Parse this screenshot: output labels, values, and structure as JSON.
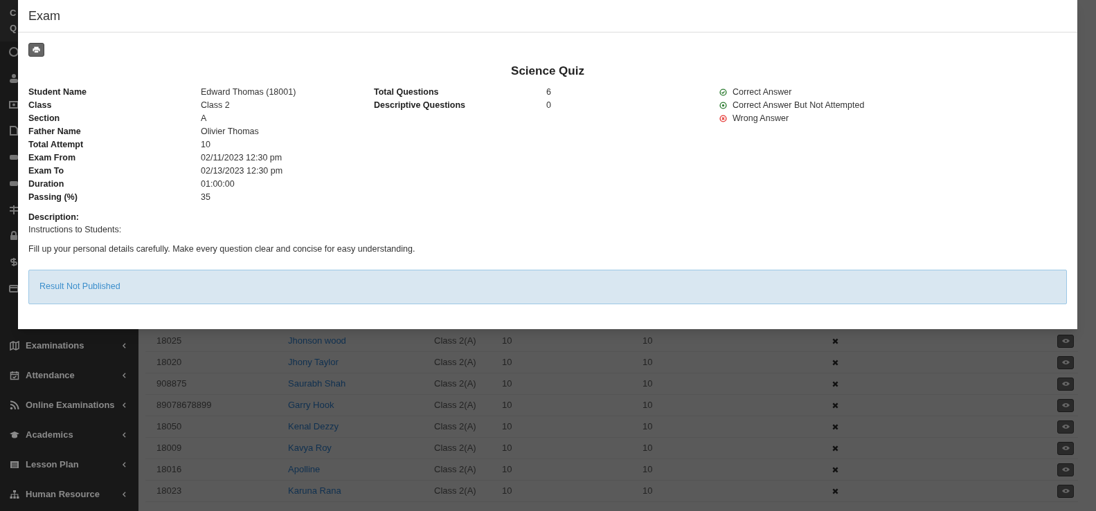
{
  "sidebar": {
    "header_fragments": [
      "C",
      "Q"
    ],
    "items": [
      {
        "label": "Examinations"
      },
      {
        "label": "Attendance"
      },
      {
        "label": "Online Examinations"
      },
      {
        "label": "Academics"
      },
      {
        "label": "Lesson Plan"
      },
      {
        "label": "Human Resource"
      }
    ]
  },
  "table": {
    "rows": [
      {
        "column_1": "18025",
        "column_2": "Jhonson wood",
        "column_3": "Class 2(A)",
        "column_4": "10",
        "column_5": "10"
      },
      {
        "column_1": "18020",
        "column_2": "Jhony Taylor",
        "column_3": "Class 2(A)",
        "column_4": "10",
        "column_5": "10"
      },
      {
        "column_1": "908875",
        "column_2": "Saurabh Shah",
        "column_3": "Class 2(A)",
        "column_4": "10",
        "column_5": "10"
      },
      {
        "column_1": "89078678899",
        "column_2": "Garry Hook",
        "column_3": "Class 2(A)",
        "column_4": "10",
        "column_5": "10"
      },
      {
        "column_1": "18050",
        "column_2": "Kenal Dezzy",
        "column_3": "Class 2(A)",
        "column_4": "10",
        "column_5": "10"
      },
      {
        "column_1": "18009",
        "column_2": "Kavya Roy",
        "column_3": "Class 2(A)",
        "column_4": "10",
        "column_5": "10"
      },
      {
        "column_1": "18016",
        "column_2": "Apolline",
        "column_3": "Class 2(A)",
        "column_4": "10",
        "column_5": "10"
      },
      {
        "column_1": "18023",
        "column_2": "Karuna Rana",
        "column_3": "Class 2(A)",
        "column_4": "10",
        "column_5": "10"
      }
    ]
  },
  "modal": {
    "title": "Exam",
    "exam_title": "Science Quiz",
    "details": [
      {
        "label": "Student Name",
        "value": "Edward Thomas (18001)"
      },
      {
        "label": "Class",
        "value": "Class 2"
      },
      {
        "label": "Section",
        "value": "A"
      },
      {
        "label": "Father Name",
        "value": "Olivier Thomas"
      },
      {
        "label": "Total Attempt",
        "value": "10"
      },
      {
        "label": "Exam From",
        "value": "02/11/2023 12:30 pm"
      },
      {
        "label": "Exam To",
        "value": "02/13/2023 12:30 pm"
      },
      {
        "label": "Duration",
        "value": "01:00:00"
      },
      {
        "label": "Passing (%)",
        "value": "35"
      }
    ],
    "summary": [
      {
        "label": "Total Questions",
        "value": "6"
      },
      {
        "label": "Descriptive Questions",
        "value": "0"
      }
    ],
    "legend": [
      {
        "kind": "correct",
        "label": "Correct Answer"
      },
      {
        "kind": "not_attempted",
        "label": "Correct Answer But Not Attempted"
      },
      {
        "kind": "wrong",
        "label": "Wrong Answer"
      }
    ],
    "description_label": "Description:",
    "description_lines": [
      "Instructions to Students:",
      "Fill up your personal details carefully. Make every question clear and concise for easy understanding."
    ],
    "alert": "Result Not Published"
  }
}
